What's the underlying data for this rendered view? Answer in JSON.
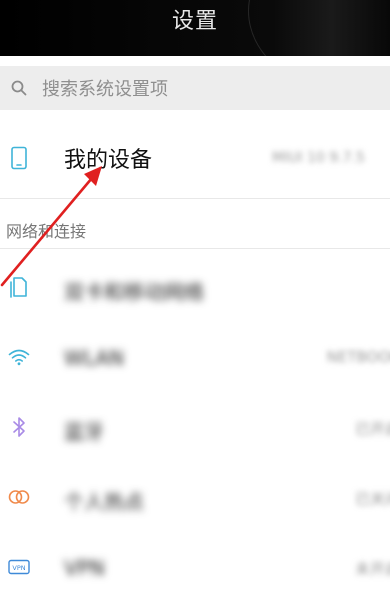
{
  "title_bar": {
    "title": "设置"
  },
  "search": {
    "placeholder": "搜索系统设置项"
  },
  "device": {
    "label": "我的设备",
    "value": "MIUI 10 9.7.5"
  },
  "network_section": {
    "header": "网络和连接",
    "items": [
      {
        "label": "双卡和移动网络",
        "value": "",
        "icon": "sim-card-icon"
      },
      {
        "label": "WLAN",
        "value": "NETBOOK",
        "icon": "wifi-icon"
      },
      {
        "label": "蓝牙",
        "value": "已开启",
        "icon": "bluetooth-icon"
      },
      {
        "label": "个人热点",
        "value": "已关闭",
        "icon": "hotspot-icon"
      },
      {
        "label": "VPN",
        "value": "未开启",
        "icon": "vpn-icon"
      }
    ]
  },
  "colors": {
    "title_bar_bg": "#000000",
    "search_bg": "#ededed",
    "accent_blue": "#3fb4d8",
    "annotation_red": "#e02020"
  }
}
